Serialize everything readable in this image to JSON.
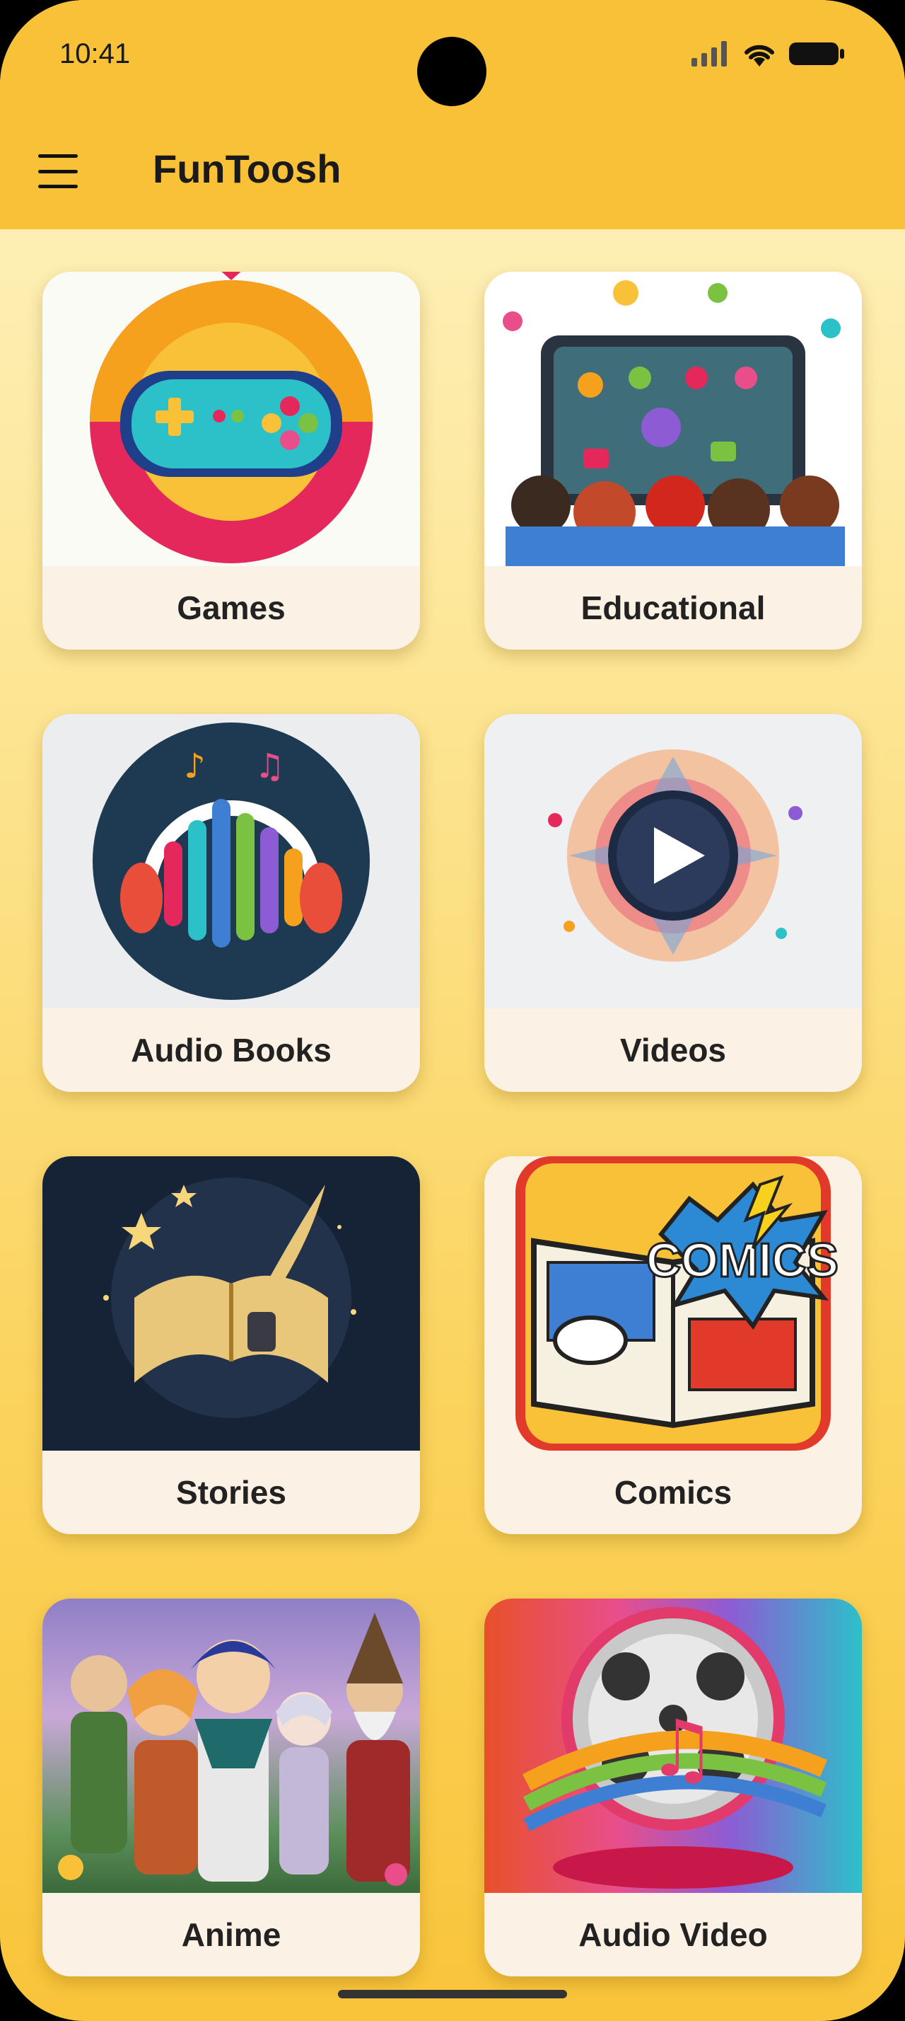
{
  "status_bar": {
    "time": "10:41",
    "icons": [
      "signal-icon",
      "wifi-icon",
      "battery-icon"
    ]
  },
  "header": {
    "title": "FunToosh",
    "menu_icon": "hamburger-menu-icon"
  },
  "categories": [
    {
      "label": "Games"
    },
    {
      "label": "Educational"
    },
    {
      "label": "Audio Books"
    },
    {
      "label": "Videos"
    },
    {
      "label": "Stories"
    },
    {
      "label": "Comics"
    },
    {
      "label": "Anime"
    },
    {
      "label": "Audio Video"
    }
  ],
  "comics_badge_text": "COMICS",
  "colors": {
    "header": "#f8c137",
    "card_label_bg": "#fbf1e4",
    "text": "#1a1a1a"
  }
}
